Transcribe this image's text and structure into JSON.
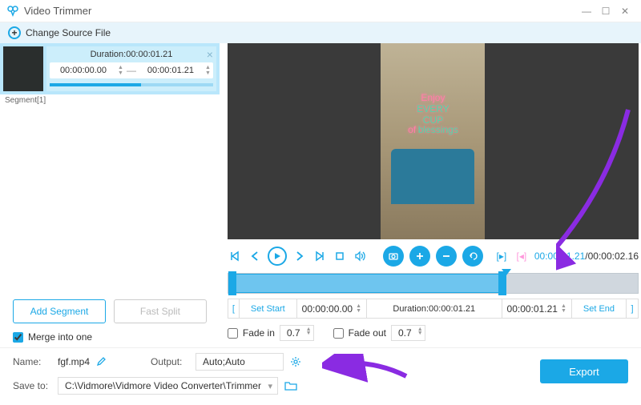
{
  "window": {
    "title": "Video Trimmer"
  },
  "toolbar": {
    "change_source": "Change Source File"
  },
  "segment": {
    "label": "Segment[1]",
    "duration_label": "Duration:00:00:01.21",
    "start": "00:00:00.00",
    "end": "00:00:01.21"
  },
  "sidebar": {
    "add_segment": "Add Segment",
    "fast_split": "Fast Split",
    "merge": "Merge into one"
  },
  "preview": {
    "neon_line1_a": "Enjoy",
    "neon_line1_b": "EVERY CUP",
    "neon_line2_a": "of",
    "neon_line2_b": "blessings"
  },
  "timecode": {
    "current": "00:00:01.21",
    "total": "/00:00:02.16"
  },
  "timerow": {
    "set_start": "Set Start",
    "start_val": "00:00:00.00",
    "duration": "Duration:00:00:01.21",
    "end_val": "00:00:01.21",
    "set_end": "Set End"
  },
  "fades": {
    "fade_in_label": "Fade in",
    "fade_in_val": "0.7",
    "fade_out_label": "Fade out",
    "fade_out_val": "0.7"
  },
  "footer": {
    "name_label": "Name:",
    "name_val": "fgf.mp4",
    "output_label": "Output:",
    "output_val": "Auto;Auto",
    "saveto_label": "Save to:",
    "saveto_val": "C:\\Vidmore\\Vidmore Video Converter\\Trimmer",
    "export": "Export"
  }
}
